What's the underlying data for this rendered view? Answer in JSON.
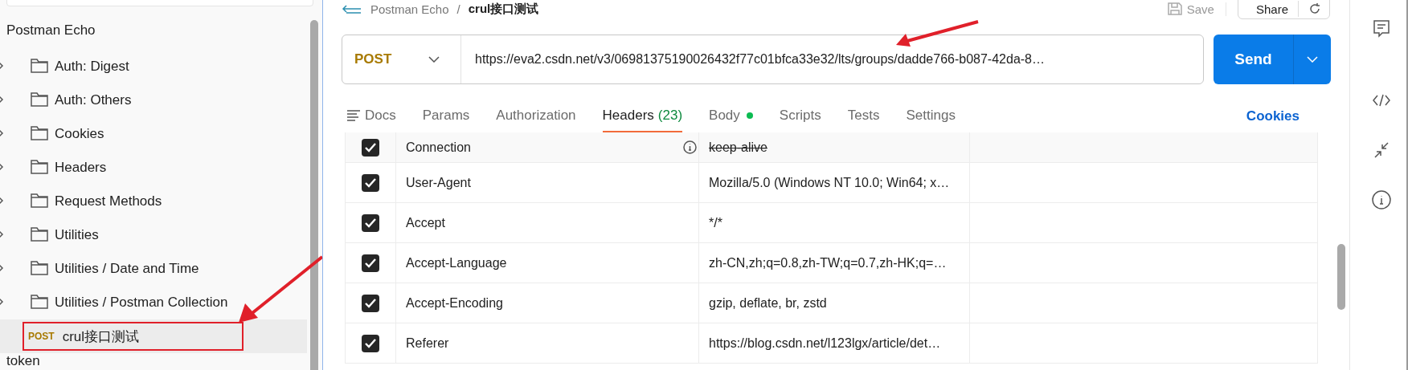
{
  "sidebar": {
    "collection": "Postman Echo",
    "items": [
      {
        "kind": "folder",
        "label": "Auth: Digest",
        "expanded": false
      },
      {
        "kind": "folder",
        "label": "Auth: Others",
        "expanded": false
      },
      {
        "kind": "folder",
        "label": "Cookies",
        "expanded": false
      },
      {
        "kind": "folder",
        "label": "Headers",
        "expanded": false
      },
      {
        "kind": "folder",
        "label": "Request Methods",
        "expanded": false
      },
      {
        "kind": "folder",
        "label": "Utilities",
        "expanded": false
      },
      {
        "kind": "folder",
        "label": "Utilities / Date and Time",
        "expanded": false
      },
      {
        "kind": "folder",
        "label": "Utilities / Postman Collection",
        "expanded": false
      },
      {
        "kind": "request",
        "method": "POST",
        "label": "crul接口测试",
        "selected": true
      }
    ],
    "next_collection": "token"
  },
  "breadcrumb": {
    "parent": "Postman Echo",
    "separator": "/",
    "current": "crul接口测试"
  },
  "toolbar": {
    "save": "Save",
    "share": "Share"
  },
  "request": {
    "method": "POST",
    "url": "https://eva2.csdn.net/v3/06981375190026432f77c01bfca33e32/lts/groups/dadde766-b087-42da-8…",
    "send": "Send"
  },
  "tabs": [
    {
      "label": "Docs",
      "kind": "docs",
      "selected": false
    },
    {
      "label": "Params",
      "selected": false
    },
    {
      "label": "Authorization",
      "selected": false
    },
    {
      "label": "Headers",
      "count": "(23)",
      "selected": true
    },
    {
      "label": "Body",
      "dot": true,
      "selected": false
    },
    {
      "label": "Scripts",
      "selected": false
    },
    {
      "label": "Tests",
      "selected": false
    },
    {
      "label": "Settings",
      "selected": false
    }
  ],
  "cookies": "Cookies",
  "headers": [
    {
      "checked": true,
      "key": "Connection",
      "value": "keep-alive",
      "overridden": true
    },
    {
      "checked": true,
      "key": "User-Agent",
      "value": "Mozilla/5.0 (Windows NT 10.0; Win64; x…",
      "overridden": false
    },
    {
      "checked": true,
      "key": "Accept",
      "value": "*/*",
      "overridden": false
    },
    {
      "checked": true,
      "key": "Accept-Language",
      "value": "zh-CN,zh;q=0.8,zh-TW;q=0.7,zh-HK;q=…",
      "overridden": false
    },
    {
      "checked": true,
      "key": "Accept-Encoding",
      "value": "gzip, deflate, br, zstd",
      "overridden": false
    },
    {
      "checked": true,
      "key": "Referer",
      "value": "https://blog.csdn.net/l123lgx/article/det…",
      "overridden": false
    }
  ]
}
